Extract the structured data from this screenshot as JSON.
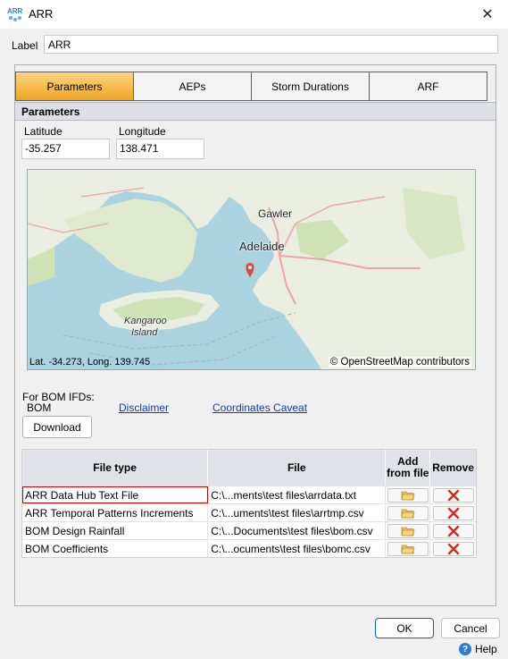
{
  "window": {
    "title": "ARR",
    "close_glyph": "✕",
    "app_icon": "arr-app-icon"
  },
  "label": {
    "caption": "Label",
    "value": "ARR"
  },
  "tabs": [
    {
      "label": "Parameters",
      "active": true
    },
    {
      "label": "AEPs",
      "active": false
    },
    {
      "label": "Storm Durations",
      "active": false
    },
    {
      "label": "ARF",
      "active": false
    }
  ],
  "section": {
    "title": "Parameters"
  },
  "latitude": {
    "caption": "Latitude",
    "value": "-35.257"
  },
  "longitude": {
    "caption": "Longitude",
    "value": "138.471"
  },
  "map": {
    "labels": {
      "gawler": "Gawler",
      "adelaide": "Adelaide",
      "kangaroo": "Kangaroo",
      "island": "Island"
    },
    "cursor_readout": "Lat. -34.273, Long. 139.745",
    "attribution": "© OpenStreetMap contributors",
    "colors": {
      "sea": "#aad3df",
      "land": "#e9eee0",
      "green": "#cfe2b6",
      "road": "#e8a6a6",
      "marker": "#d94a3d"
    }
  },
  "bom": {
    "caption": "For BOM IFDs:",
    "source": "BOM",
    "disclaimer_link": "Disclaimer",
    "caveat_link": "Coordinates Caveat",
    "download_label": "Download"
  },
  "table": {
    "headers": {
      "file_type": "File type",
      "file": "File",
      "add": "Add from file",
      "remove": "Remove"
    },
    "rows": [
      {
        "file_type": "ARR Data Hub Text File",
        "file": "C:\\...ments\\test files\\arrdata.txt",
        "selected": true
      },
      {
        "file_type": "ARR Temporal Patterns Increments",
        "file": "C:\\...uments\\test files\\arrtmp.csv",
        "selected": false
      },
      {
        "file_type": "BOM Design Rainfall",
        "file": "C:\\...Documents\\test files\\bom.csv",
        "selected": false
      },
      {
        "file_type": "BOM Coefficients",
        "file": "C:\\...ocuments\\test files\\bomc.csv",
        "selected": false
      }
    ],
    "icons": {
      "add": "folder-open-icon",
      "remove": "red-x-icon"
    }
  },
  "buttons": {
    "ok": "OK",
    "cancel": "Cancel",
    "help": "Help",
    "help_glyph": "?"
  },
  "accent": {
    "tab_active": "#f1a420",
    "selection": "#d00000",
    "link": "#0b3fb5"
  }
}
